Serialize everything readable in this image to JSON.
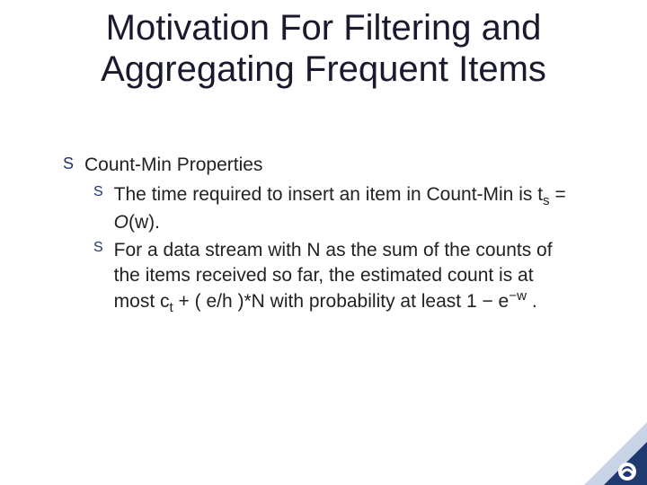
{
  "title": "Motivation For Filtering and Aggregating Frequent Items",
  "bullets": {
    "level1": {
      "label": "Count-Min Properties"
    },
    "level2": [
      {
        "pre": "The time required to insert an item in Count-Min is t",
        "sub1": "s",
        "mid1": " = ",
        "ital": "O",
        "post": "(w)."
      },
      {
        "pre": "For a data stream with N as the sum of the counts of the items received so far, the estimated count is at most c",
        "sub1": "t",
        "mid1": " + ( e/h )*N with probability at least 1 − e",
        "sup1": "−w",
        "post": " ."
      }
    ]
  },
  "bullet_glyph": "S",
  "corner_color_dark": "#1f3a6e",
  "corner_color_light": "#c9d3e6"
}
